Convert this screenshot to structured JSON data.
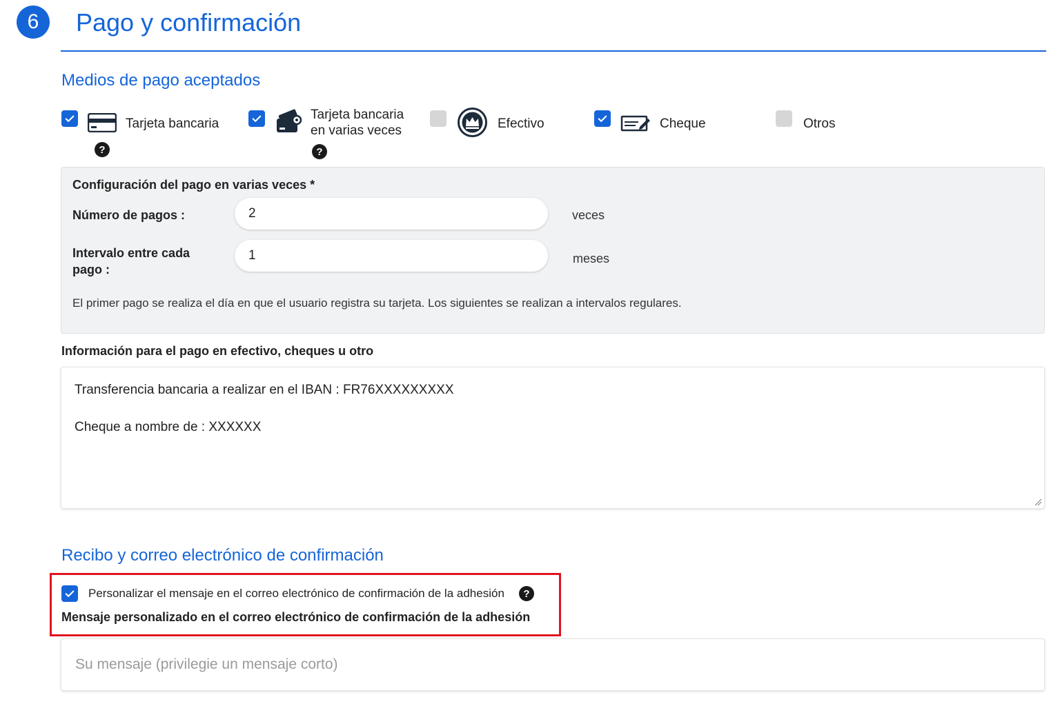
{
  "header": {
    "step_number": "6",
    "title": "Pago y confirmación"
  },
  "payment_methods": {
    "section_title": "Medios de pago aceptados",
    "items": [
      {
        "label": "Tarjeta bancaria",
        "checked": true,
        "icon": "credit-card-icon",
        "help": "?"
      },
      {
        "label_line1": "Tarjeta bancaria",
        "label_line2": "en varias veces",
        "checked": true,
        "icon": "recurring-card-icon",
        "help": "?"
      },
      {
        "label": "Efectivo",
        "checked": false,
        "icon": "cash-crown-icon"
      },
      {
        "label": "Cheque",
        "checked": true,
        "icon": "cheque-icon"
      },
      {
        "label": "Otros",
        "checked": false
      }
    ]
  },
  "installments": {
    "title": "Configuración del pago en varias veces *",
    "num_payments_label": "Número de pagos :",
    "num_payments_value": "2",
    "num_payments_unit": "veces",
    "interval_label_line1": "Intervalo entre cada",
    "interval_label_line2": "pago :",
    "interval_value": "1",
    "interval_unit": "meses",
    "note": "El primer pago se realiza el día en que el usuario registra su tarjeta. Los siguientes se realizan a intervalos regulares."
  },
  "payment_info": {
    "label": "Información para el pago en efectivo, cheques u otro",
    "line1": "Transferencia bancaria a realizar en el IBAN : FR76XXXXXXXXX",
    "line2": "Cheque a nombre de : XXXXXX"
  },
  "receipt": {
    "section_title": "Recibo y correo electrónico de confirmación",
    "customize_label": "Personalizar el mensaje en el correo electrónico de confirmación de la adhesión",
    "customize_checked": true,
    "help": "?",
    "custom_message_label": "Mensaje personalizado en el correo electrónico de confirmación de la adhesión",
    "message_placeholder": "Su mensaje (privilegie un mensaje corto)"
  },
  "colors": {
    "accent": "#1565d8",
    "highlight": "#e0141e",
    "panel": "#f1f2f4"
  }
}
